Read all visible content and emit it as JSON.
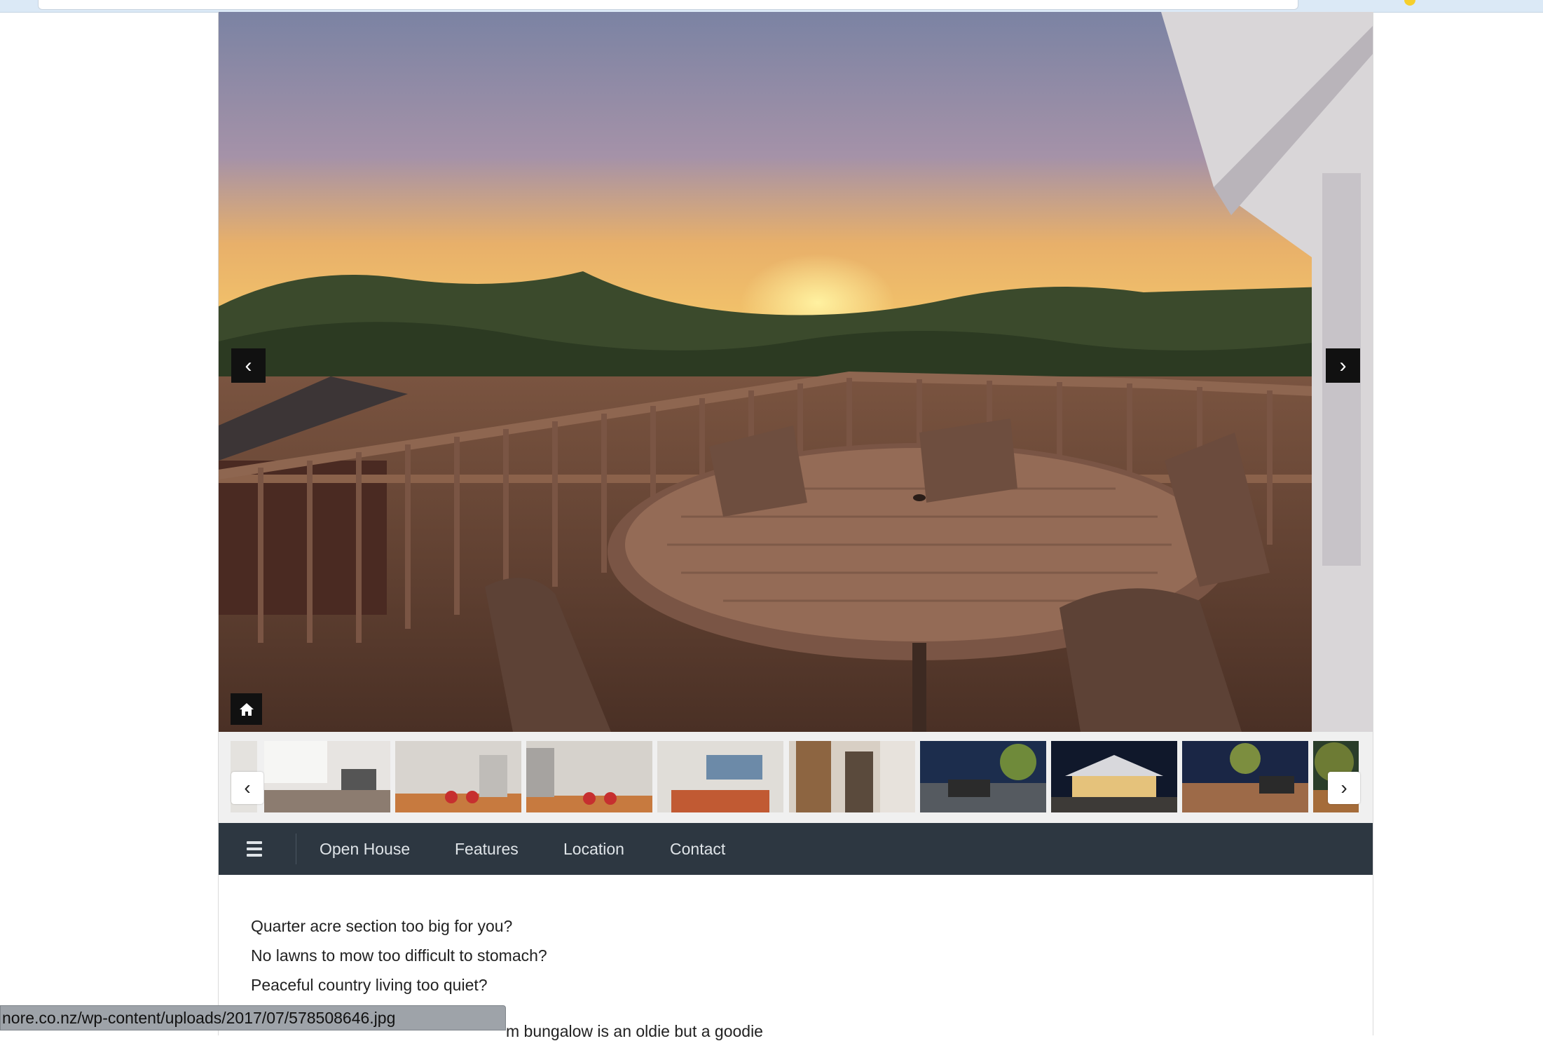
{
  "browser": {
    "status_url": "nore.co.nz/wp-content/uploads/2017/07/578508646.jpg"
  },
  "hero": {
    "prev_icon": "chevron-left-icon",
    "next_icon": "chevron-right-icon",
    "home_icon": "home-icon",
    "prev_glyph": "‹",
    "next_glyph": "›"
  },
  "thumbnails": {
    "items": [
      {
        "name": "thumb-partial-left"
      },
      {
        "name": "thumb-living-room"
      },
      {
        "name": "thumb-kitchen-1"
      },
      {
        "name": "thumb-kitchen-2"
      },
      {
        "name": "thumb-lounge"
      },
      {
        "name": "thumb-hallway"
      },
      {
        "name": "thumb-deck-night-1"
      },
      {
        "name": "thumb-house-night"
      },
      {
        "name": "thumb-deck-night-2"
      },
      {
        "name": "thumb-partial-right"
      }
    ],
    "prev_glyph": "‹",
    "next_glyph": "›"
  },
  "nav": {
    "menu_icon": "hamburger-menu-icon",
    "links": [
      "Open House",
      "Features",
      "Location",
      "Contact"
    ]
  },
  "content": {
    "lines": [
      "Quarter acre section too big for you?",
      "No lawns to mow too difficult to stomach?",
      "Peaceful country living too quiet?"
    ],
    "partial_line": "m bungalow is an oldie but a goodie"
  },
  "colors": {
    "nav_bg": "#2d3741",
    "nav_text": "#dfe4e8",
    "strip_bg": "#f0f0f0",
    "control_bg": "#111111"
  }
}
